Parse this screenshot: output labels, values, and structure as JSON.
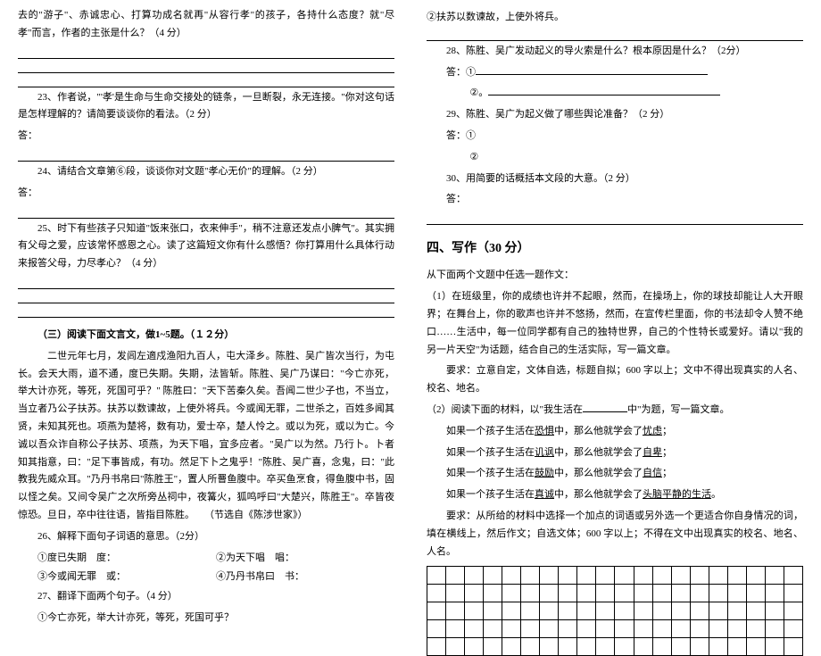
{
  "left": {
    "p1": "去的\"游子\"、赤诚忠心、打算功成名就再\"从容行孝\"的孩子，各持什么态度？就\"尽孝\"而言，作者的主张是什么？（4 分）",
    "q23": "23、作者说，\"'孝'是生命与生命交接处的链条，一旦断裂，永无连接。\"你对这句话是怎样理解的？请简要谈谈你的看法。（2 分）",
    "q24": "24、请结合文章第⑥段，谈谈你对文题\"孝心无价\"的理解。（2 分）",
    "q25": "25、时下有些孩子只知道\"饭来张口，衣来伸手\"，稍不注意还发点小脾气\"。其实拥有父母之爱，应该常怀感恩之心。读了这篇短文你有什么感悟？你打算用什么具体行动来报答父母，力尽孝心？（4 分）",
    "ans_label": "答：",
    "sec3_title": "（三）阅读下面文言文，做1~5题。（１２分）",
    "passage": "二世元年七月，发闾左適戍渔阳九百人，屯大泽乡。陈胜、吴广皆次当行，为屯长。会天大雨，道不通，度已失期。失期，法皆斩。陈胜、吴广乃谋曰：\"今亡亦死，举大计亦死，等死，死国可乎？\" 陈胜曰：\"天下苦秦久矣。吾闻二世少子也，不当立，当立者乃公子扶苏。扶苏以数谏故，上使外将兵。今或闻无罪，二世杀之，百姓多闻其贤，未知其死也。项燕为楚将，数有功，爱士卒，楚人怜之。或以为死，或以为亡。今诚以吾众诈自称公子扶苏、项燕，为天下唱，宜多应者。\"吴广以为然。乃行卜。卜者知其指意，曰：\"足下事皆成，有功。然足下卜之鬼乎！\"陈胜、吴广喜，念鬼，曰：\"此教我先威众耳。\"乃丹书帛曰\"陈胜王\"，置人所罾鱼腹中。卒买鱼烹食，得鱼腹中书，固以怪之矣。又间令吴广之次所旁丛祠中，夜篝火，狐鸣呼曰\"大楚兴，陈胜王\"。卒皆夜惊恐。旦日，卒中往往语，皆指目陈胜。　　（节选自《陈涉世家》）",
    "q26": "26、解释下面句子词语的意思。（2分）",
    "q26_1": "①度已失期 度：",
    "q26_2": "②为天下唱 唱：",
    "q26_3": "③今或闻无罪 或：",
    "q26_4": "④乃丹书帛曰 书：",
    "q27": "27、翻译下面两个句子。（4 分）",
    "q27_1": "①今亡亦死，举大计亦死，等死，死国可乎？"
  },
  "right": {
    "q27_2": "②扶苏以数谏故，上使外将兵。",
    "q28": "28、陈胜、吴广发动起义的导火索是什么？根本原因是什么？（2分）",
    "q28_1": "答：①",
    "q28_2": "②。",
    "q29": "29、陈胜、吴广为起义做了哪些舆论准备？（2 分）",
    "q29_1": "答：①",
    "q29_2": "②",
    "q30": "30、用简要的话概括本文段的大意。（2 分）",
    "q30_ans": "答：",
    "sec4_title": "四、写作（30 分）",
    "sec4_intro": "从下面两个文题中任选一题作文：",
    "w1_p1": "（1）在班级里，你的成绩也许并不起眼，然而，在操场上，你的球技却能让人大开眼界；在舞台上，你的歌声也许并不悠扬，然而，在宣传栏里面，你的书法却令人赞不绝口……生活中，每一位同学都有自己的独特世界，自己的个性特长或爱好。请以\"我的另一片天空\"为话题，结合自己的生活实际，写一篇文章。",
    "w1_req": "要求：立意自定，文体自选，标题自拟；600 字以上；文中不得出现真实的人名、校名、地名。",
    "w2_intro": "（2）阅读下面的材料，以\"我生活在",
    "w2_intro_suffix": "中\"为题，写一篇文章。",
    "w2_l1a": "如果一个孩子生活在",
    "w2_l1b": "恐惧",
    "w2_l1c": "中，那么他就学会了",
    "w2_l1d": "忧虑",
    "w2_l1e": "；",
    "w2_l2b": "讥讽",
    "w2_l2d": "自卑",
    "w2_l3b": "鼓励",
    "w2_l3d": "自信",
    "w2_l4b": "真诚",
    "w2_l4d": "头脑平静的生活",
    "w2_l4e": "。",
    "w2_req1": "要求：从所给的材料中选择一个加点的词语或另外选一个更适合你自身情况的词，填在横线上，然后作文；自选文体；600 字以上；不得在文中出现真实的校名、地名、人名。"
  }
}
